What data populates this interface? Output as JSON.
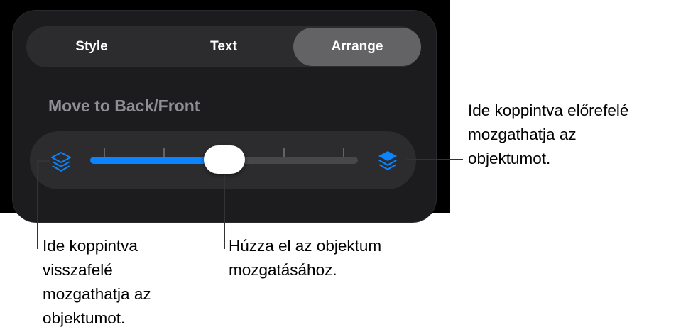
{
  "tabs": [
    {
      "label": "Style"
    },
    {
      "label": "Text"
    },
    {
      "label": "Arrange",
      "selected": true
    }
  ],
  "section": {
    "title": "Move to Back/Front"
  },
  "slider": {
    "value": 0.5,
    "tick_count": 4,
    "back_icon": "layers-back-icon",
    "front_icon": "layers-front-icon",
    "accent_color": "#0a84ff"
  },
  "callouts": {
    "back": [
      "Ide koppintva",
      "visszafelé",
      "mozgathatja az",
      "objektumot."
    ],
    "thumb": [
      "Húzza el az objektum",
      "mozgatásához."
    ],
    "front": [
      "Ide koppintva előrefelé",
      "mozgathatja az",
      "objektumot."
    ]
  }
}
